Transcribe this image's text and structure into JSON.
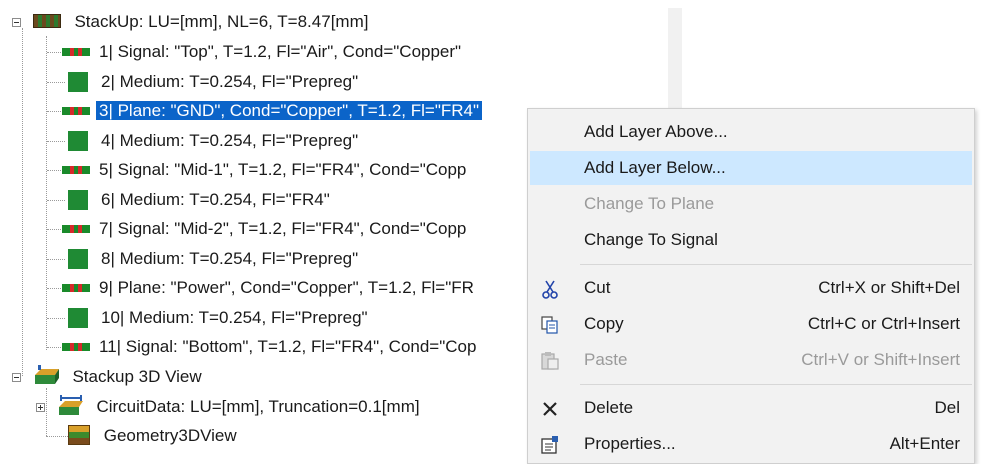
{
  "tree": {
    "root_label": "StackUp: LU=[mm], NL=6, T=8.47[mm]",
    "layers": [
      {
        "label": "1| Signal: \"Top\", T=1.2, Fl=\"Air\", Cond=\"Copper\"",
        "kind": "signal"
      },
      {
        "label": "2| Medium: T=0.254, Fl=\"Prepreg\"",
        "kind": "medium"
      },
      {
        "label": "3| Plane: \"GND\", Cond=\"Copper\", T=1.2, Fl=\"FR4\"",
        "kind": "plane",
        "selected": true
      },
      {
        "label": "4| Medium: T=0.254, Fl=\"Prepreg\"",
        "kind": "medium"
      },
      {
        "label": "5| Signal: \"Mid-1\", T=1.2, Fl=\"FR4\", Cond=\"Copp",
        "kind": "signal"
      },
      {
        "label": "6| Medium: T=0.254, Fl=\"FR4\"",
        "kind": "medium"
      },
      {
        "label": "7| Signal: \"Mid-2\", T=1.2, Fl=\"FR4\", Cond=\"Copp",
        "kind": "signal"
      },
      {
        "label": "8| Medium: T=0.254, Fl=\"Prepreg\"",
        "kind": "medium"
      },
      {
        "label": "9| Plane: \"Power\", Cond=\"Copper\", T=1.2, Fl=\"FR",
        "kind": "plane"
      },
      {
        "label": "10| Medium: T=0.254, Fl=\"Prepreg\"",
        "kind": "medium"
      },
      {
        "label": "11| Signal: \"Bottom\", T=1.2, Fl=\"FR4\", Cond=\"Cop",
        "kind": "signal"
      }
    ],
    "view3d_label": "Stackup 3D View",
    "circuit_label": "CircuitData: LU=[mm], Truncation=0.1[mm]",
    "geometry_label": "Geometry3DView"
  },
  "context_menu": {
    "add_above": "Add Layer Above...",
    "add_below": "Add Layer Below...",
    "to_plane": "Change To Plane",
    "to_signal": "Change To Signal",
    "cut": "Cut",
    "cut_shortcut": "Ctrl+X or Shift+Del",
    "copy": "Copy",
    "copy_shortcut": "Ctrl+C or Ctrl+Insert",
    "paste": "Paste",
    "paste_shortcut": "Ctrl+V or Shift+Insert",
    "delete": "Delete",
    "delete_shortcut": "Del",
    "properties": "Properties...",
    "properties_shortcut": "Alt+Enter"
  },
  "colors": {
    "selection": "#0b64c9",
    "menu_hover": "#cde8ff",
    "menu_background": "#f2f2f2"
  }
}
